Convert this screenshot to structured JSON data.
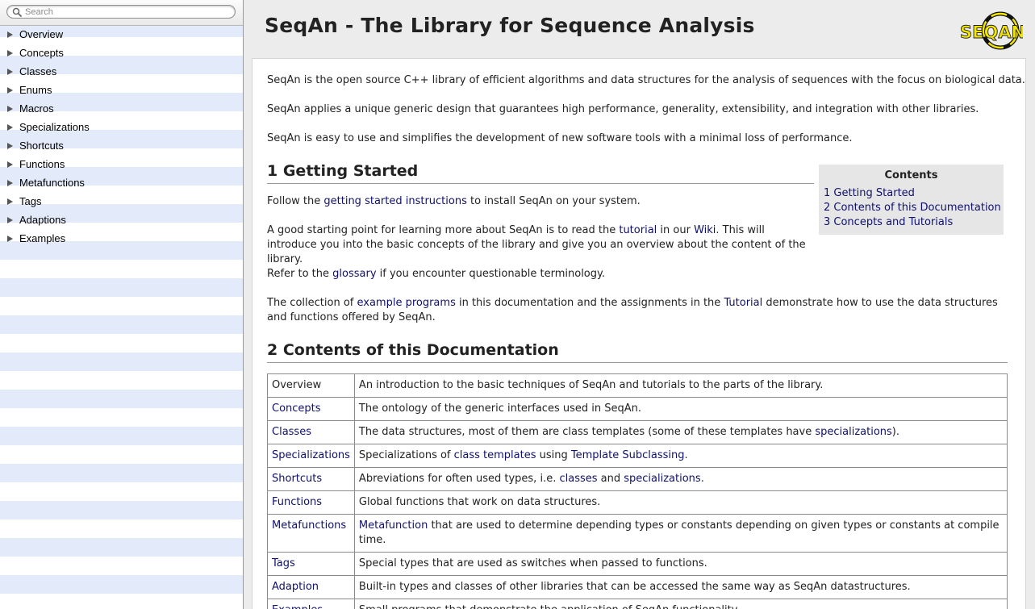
{
  "search": {
    "placeholder": "Search"
  },
  "sidebar": {
    "items": [
      {
        "label": "Overview"
      },
      {
        "label": "Concepts"
      },
      {
        "label": "Classes"
      },
      {
        "label": "Enums"
      },
      {
        "label": "Macros"
      },
      {
        "label": "Specializations"
      },
      {
        "label": "Shortcuts"
      },
      {
        "label": "Functions"
      },
      {
        "label": "Metafunctions"
      },
      {
        "label": "Tags"
      },
      {
        "label": "Adaptions"
      },
      {
        "label": "Examples"
      }
    ]
  },
  "header": {
    "title": "SeqAn - The Library for Sequence Analysis",
    "logo_text": "SEQAN"
  },
  "intro": {
    "p1": "SeqAn is the open source C++ library of efficient algorithms and data structures for the analysis of sequences with the focus on biological data.",
    "p2": "SeqAn applies a unique generic design that guarantees high performance, generality, extensibility, and integration with other libraries.",
    "p3": "SeqAn is easy to use and simplifies the development of new software tools with a minimal loss of performance."
  },
  "section1": {
    "heading": "1 Getting Started",
    "p1": {
      "pre": "Follow the ",
      "link": "getting started instructions",
      "post": " to install SeqAn on your system."
    },
    "p2": {
      "pre": "A good starting point for learning more about SeqAn is to read the ",
      "link1": "tutorial",
      "mid": " in our ",
      "link2": "Wiki",
      "post": ". This will introduce you into the basic concepts of the library and give you an overview about the content of the library."
    },
    "p3": {
      "pre": "Refer to the ",
      "link": "glossary",
      "post": " if you encounter questionable terminology."
    },
    "p4": {
      "pre": "The collection of ",
      "link1": "example programs",
      "mid": " in this documentation and the assignments in the ",
      "link2": "Tutorial",
      "post": " demonstrate how to use the data structures and functions offered by SeqAn."
    }
  },
  "toc": {
    "title": "Contents",
    "items": [
      "1 Getting Started",
      "2 Contents of this Documentation",
      "3 Concepts and Tutorials"
    ]
  },
  "section2": {
    "heading": "2 Contents of this Documentation",
    "rows": [
      {
        "key": "Overview",
        "pre": "An introduction to the basic techniques of SeqAn and tutorials to the parts of the library."
      },
      {
        "key": "Concepts",
        "pre": "The ontology of the generic interfaces used in SeqAn."
      },
      {
        "key": "Classes",
        "pre": "The data structures, most of them are class templates (some of these templates have ",
        "link1": "specializations",
        "post": ")."
      },
      {
        "key": "Specializations",
        "pre": "Specializations of ",
        "link1": "class templates",
        "mid": " using ",
        "link2": "Template Subclassing",
        "post": "."
      },
      {
        "key": "Shortcuts",
        "pre": "Abreviations for often used types, i.e. ",
        "link1": "classes",
        "mid": " and ",
        "link2": "specializations",
        "post": "."
      },
      {
        "key": "Functions",
        "pre": "Global functions that work on data structures."
      },
      {
        "key": "Metafunctions",
        "link1": "Metafunction",
        "post": " that are used to determine depending types or constants depending on given types or constants at compile time."
      },
      {
        "key": "Tags",
        "pre": "Special types that are used as switches when passed to functions."
      },
      {
        "key": "Adaption",
        "pre": "Built-in types and classes of other libraries that can be accessed the same way as SeqAn datastructures."
      },
      {
        "key": "Examples",
        "pre": "Small programs that demonstrate the application of SeqAn functionality."
      }
    ]
  },
  "colors": {
    "link": "#10106e",
    "stripe": "#e3ebfa",
    "toc_bg": "#e6e6e6",
    "logo_yellow": "#f2e600"
  }
}
